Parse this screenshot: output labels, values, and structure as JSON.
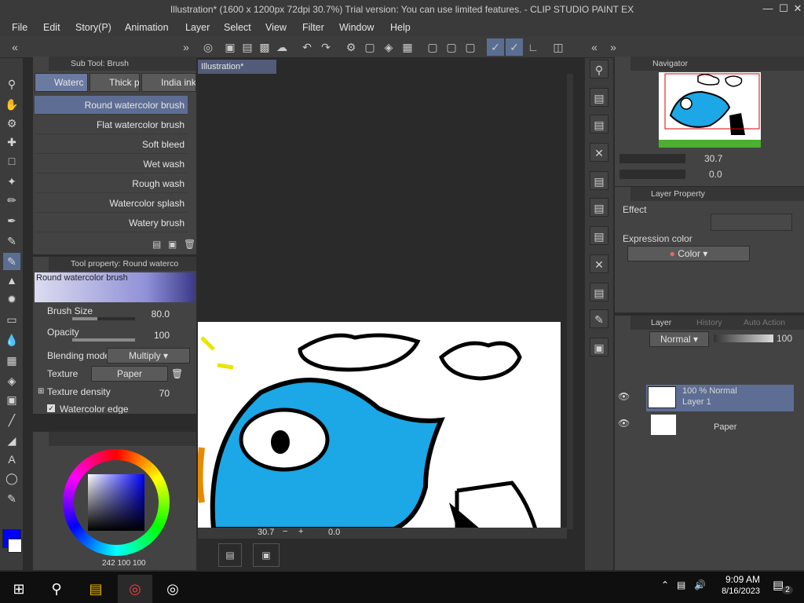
{
  "window": {
    "title": "Illustration* (1600 x 1200px 72dpi 30.7%)  Trial version: You can use limited features. - CLIP STUDIO PAINT EX"
  },
  "menu": [
    "File",
    "Edit",
    "Story(P)",
    "Animation",
    "Layer",
    "Select",
    "View",
    "Filter",
    "Window",
    "Help"
  ],
  "sub_tool": {
    "header": "Sub Tool: Brush",
    "tabs": [
      "Waterc",
      "Thick p",
      "India ink"
    ],
    "items": [
      "Round watercolor brush",
      "Flat watercolor brush",
      "Soft bleed",
      "Wet wash",
      "Rough wash",
      "Watercolor splash",
      "Watery brush"
    ],
    "selected_index": 0
  },
  "tool_property": {
    "header": "Tool property: Round waterco",
    "preview_label": "Round watercolor brush",
    "brush_size_label": "Brush Size",
    "brush_size_value": "80.0",
    "brush_size_fraction": 0.4,
    "opacity_label": "Opacity",
    "opacity_value": "100",
    "opacity_fraction": 1.0,
    "blending_mode_label": "Blending mode",
    "blending_mode_value": "Multiply",
    "texture_label": "Texture",
    "texture_value": "Paper",
    "texture_density_label": "Texture density",
    "texture_density_value": "70",
    "watercolor_edge_label": "Watercolor edge"
  },
  "color": {
    "main": "#0000ff",
    "sub": "#ffffff",
    "readout": "242",
    "readout_s": "100",
    "readout_v": "100"
  },
  "canvas": {
    "tab": "Illustration*",
    "zoom": "30.7",
    "rotation": "0.0"
  },
  "navigator": {
    "header": "Navigator",
    "zoom": "30.7",
    "rotation": "0.0"
  },
  "layer_property": {
    "header": "Layer Property",
    "effect_label": "Effect",
    "expression_label": "Expression color",
    "expression_value": "Color"
  },
  "layer_panel": {
    "tabs": [
      "Layer",
      "History",
      "Auto Action"
    ],
    "blend": "Normal",
    "opacity": "100",
    "layers": [
      {
        "line1": "100 % Normal",
        "line2": "Layer 1"
      },
      {
        "line1": "",
        "line2": "Paper"
      }
    ]
  },
  "taskbar": {
    "time": "9:09 AM",
    "date": "8/16/2023",
    "notifications": "2"
  }
}
